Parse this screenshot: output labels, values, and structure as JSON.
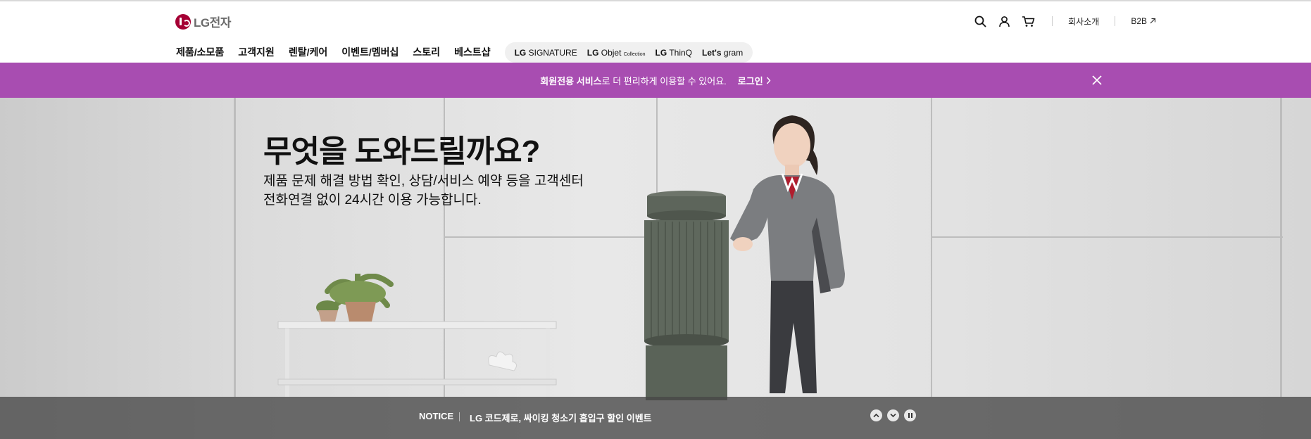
{
  "header": {
    "logo_text": "LG전자",
    "util_links": {
      "company": "회사소개",
      "b2b": "B2B"
    },
    "gnb": [
      "제품/소모품",
      "고객지원",
      "렌탈/케어",
      "이벤트/멤버십",
      "스토리",
      "베스트샵"
    ],
    "brands": {
      "signature_prefix": "LG",
      "signature": "SIGNATURE",
      "objet_prefix": "LG",
      "objet": "Objet",
      "objet_sub": "Collection",
      "thinq_prefix": "LG",
      "thinq": "ThinQ",
      "gram_prefix": "Let's",
      "gram": "gram"
    }
  },
  "banner": {
    "highlight": "회원전용 서비스",
    "message": "로 더 편리하게 이용할 수 있어요.",
    "login": "로그인",
    "bg_color": "#a84db1"
  },
  "hero": {
    "title": "무엇을 도와드릴까요?",
    "desc_line1": "제품 문제 해결 방법 확인, 상담/서비스 예약 등을 고객센터",
    "desc_line2": "전화연결 없이 24시간 이용 가능합니다."
  },
  "notice": {
    "label": "NOTICE",
    "text": "LG 코드제로, 싸이킹 청소기 흡입구 할인 이벤트"
  },
  "icons": [
    "search-icon",
    "user-icon",
    "cart-icon",
    "external-link-icon",
    "close-icon",
    "chevron-up-icon",
    "chevron-down-icon",
    "pause-icon"
  ]
}
